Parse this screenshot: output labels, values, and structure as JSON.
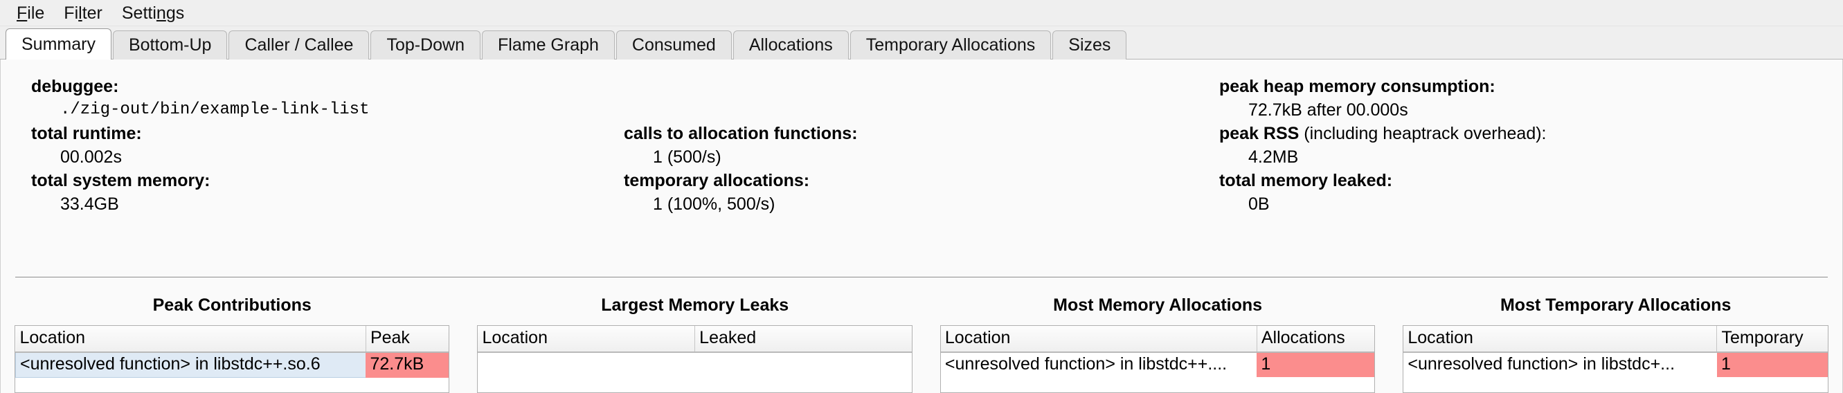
{
  "menubar": {
    "items": [
      {
        "name": "file",
        "pre": "",
        "mnemonic": "F",
        "post": "ile"
      },
      {
        "name": "filter",
        "pre": "Fi",
        "mnemonic": "l",
        "post": "ter"
      },
      {
        "name": "settings",
        "pre": "Setti",
        "mnemonic": "n",
        "post": "gs"
      }
    ]
  },
  "tabs": [
    {
      "label": "Summary",
      "active": true
    },
    {
      "label": "Bottom-Up",
      "active": false
    },
    {
      "label": "Caller / Callee",
      "active": false
    },
    {
      "label": "Top-Down",
      "active": false
    },
    {
      "label": "Flame Graph",
      "active": false
    },
    {
      "label": "Consumed",
      "active": false
    },
    {
      "label": "Allocations",
      "active": false
    },
    {
      "label": "Temporary Allocations",
      "active": false
    },
    {
      "label": "Sizes",
      "active": false
    }
  ],
  "summary": {
    "left": {
      "debuggee_key": "debuggee:",
      "debuggee_value": "./zig-out/bin/example-link-list",
      "runtime_key": "total runtime:",
      "runtime_value": "00.002s",
      "sysmem_key": "total system memory:",
      "sysmem_value": "33.4GB"
    },
    "middle": {
      "calls_key": "calls to allocation functions:",
      "calls_value": "1 (500/s)",
      "temp_key": "temporary allocations:",
      "temp_value": "1 (100%, 500/s)"
    },
    "right": {
      "peak_heap_key": "peak heap memory consumption:",
      "peak_heap_value": "72.7kB after 00.000s",
      "peak_rss_key_bold": "peak RSS",
      "peak_rss_key_rest": " (including heaptrack overhead):",
      "peak_rss_value": "4.2MB",
      "leaked_key": "total memory leaked:",
      "leaked_value": "0B"
    }
  },
  "panels": [
    {
      "title": "Peak Contributions",
      "columns": [
        "Location",
        "Peak"
      ],
      "rows": [
        {
          "location": "<unresolved function> in libstdc++.so.6",
          "value": "72.7kB",
          "selected": true,
          "hot": true
        }
      ]
    },
    {
      "title": "Largest Memory Leaks",
      "columns": [
        "Location",
        "Leaked"
      ],
      "rows": []
    },
    {
      "title": "Most Memory Allocations",
      "columns": [
        "Location",
        "Allocations"
      ],
      "rows": [
        {
          "location": "<unresolved function> in libstdc++....",
          "value": "1",
          "selected": false,
          "hot": true
        }
      ]
    },
    {
      "title": "Most Temporary Allocations",
      "columns": [
        "Location",
        "Temporary"
      ],
      "rows": [
        {
          "location": "<unresolved function> in libstdc+...",
          "value": "1",
          "selected": false,
          "hot": true
        }
      ]
    }
  ],
  "colors": {
    "hot_cell": "#fb8d8d",
    "selected_row": "#dfeaf5",
    "chrome": "#efefef",
    "content_bg": "#fafafa"
  }
}
